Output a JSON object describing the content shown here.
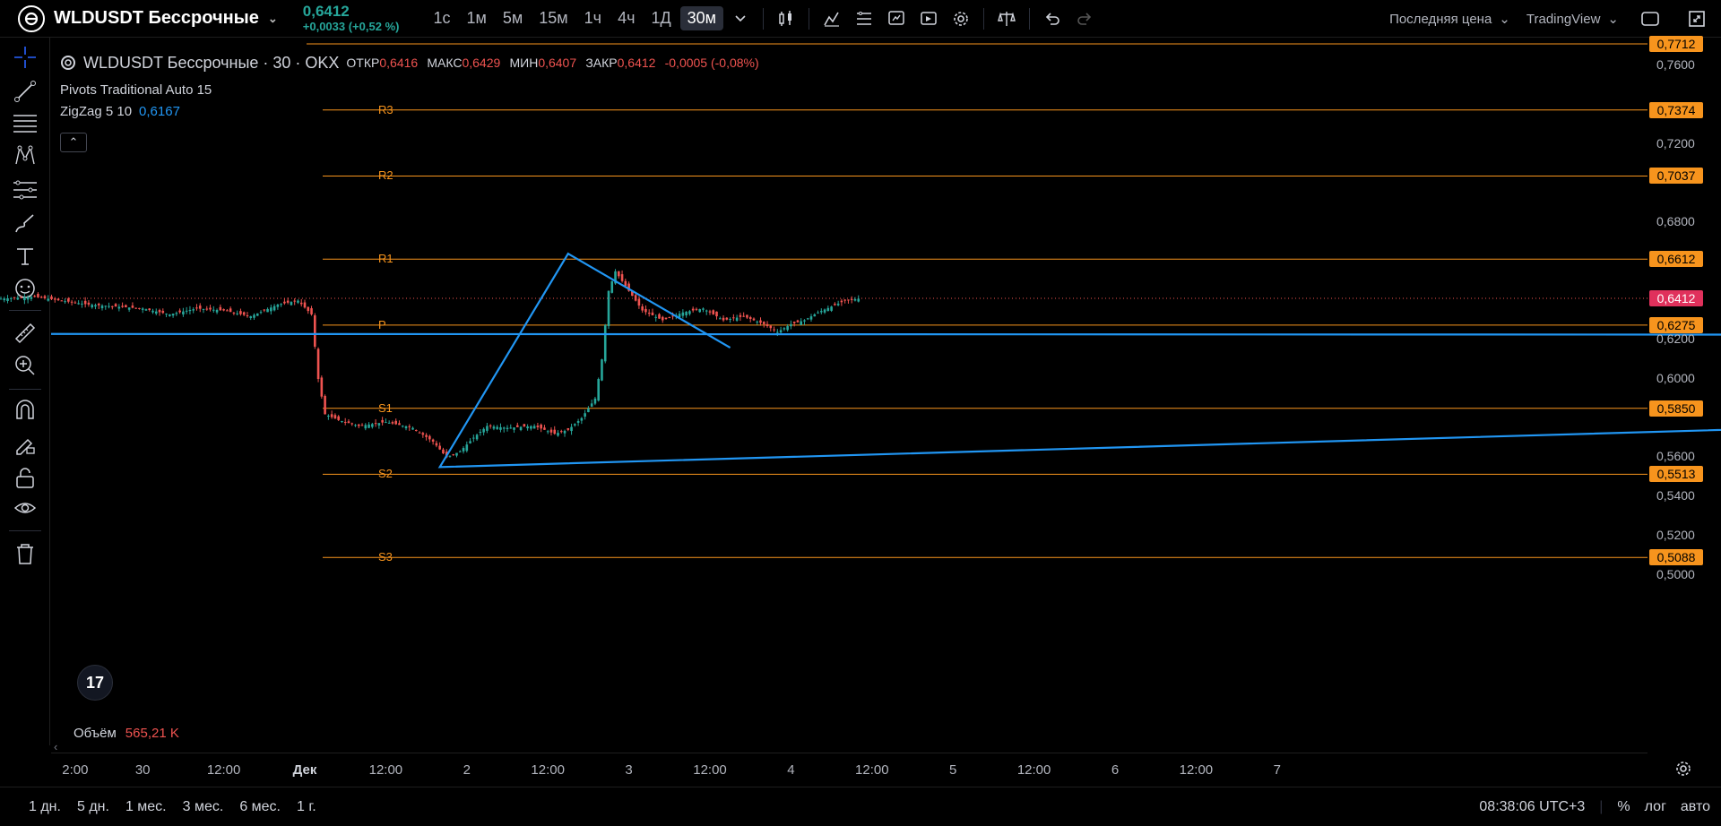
{
  "header": {
    "symbol": "WLDUSDT Бессрочные",
    "last_price": "0,6412",
    "change": "+0,0033 (+0,52 %)",
    "intervals": [
      "1с",
      "1м",
      "5м",
      "15м",
      "1ч",
      "4ч",
      "1Д",
      "30м"
    ],
    "active_interval": "30м",
    "price_type": "Последняя цена",
    "source": "TradingView"
  },
  "legend": {
    "title": "WLDUSDT Бессрочные · 30 · OKX",
    "open_label": "ОТКР",
    "open": "0,6416",
    "high_label": "МАКС",
    "high": "0,6429",
    "low_label": "МИН",
    "low": "0,6407",
    "close_label": "ЗАКР",
    "close": "0,6412",
    "change": "-0,0005 (-0,08%)",
    "indicator1": "Pivots Traditional Auto 15",
    "indicator2": "ZigZag 5 10",
    "indicator2_value": "0,6167"
  },
  "pivots": [
    {
      "label": "R3",
      "value": "0,7374"
    },
    {
      "label": "R2",
      "value": "0,7037"
    },
    {
      "label": "R1",
      "value": "0,6612"
    },
    {
      "label": "P",
      "value": "0,6275"
    },
    {
      "label": "S1",
      "value": "0,5850"
    },
    {
      "label": "S2",
      "value": "0,5513"
    },
    {
      "label": "S3",
      "value": "0,5088"
    }
  ],
  "top_level": "0,7712",
  "current_price_label": "0,6412",
  "price_ticks": [
    "0,7600",
    "0,7200",
    "0,6800",
    "0,6200",
    "0,6000",
    "0,5600",
    "0,5400",
    "0,5200",
    "0,5000"
  ],
  "time_ticks": [
    {
      "label": "2:00",
      "bold": false
    },
    {
      "label": "30",
      "bold": false
    },
    {
      "label": "12:00",
      "bold": false
    },
    {
      "label": "Дек",
      "bold": true
    },
    {
      "label": "12:00",
      "bold": false
    },
    {
      "label": "2",
      "bold": false
    },
    {
      "label": "12:00",
      "bold": false
    },
    {
      "label": "3",
      "bold": false
    },
    {
      "label": "12:00",
      "bold": false
    },
    {
      "label": "4",
      "bold": false
    },
    {
      "label": "12:00",
      "bold": false
    },
    {
      "label": "5",
      "bold": false
    },
    {
      "label": "12:00",
      "bold": false
    },
    {
      "label": "6",
      "bold": false
    },
    {
      "label": "12:00",
      "bold": false
    },
    {
      "label": "7",
      "bold": false
    }
  ],
  "volume": {
    "label": "Объём",
    "value": "565,21 K"
  },
  "ranges": [
    "1 дн.",
    "5 дн.",
    "1 мес.",
    "3 мес.",
    "6 мес.",
    "1 г."
  ],
  "clock": "08:38:06 UTC+3",
  "scale_percent": "%",
  "scale_log": "лог",
  "scale_auto": "авто",
  "colors": {
    "up": "#26a69a",
    "down": "#ef5350",
    "pivot": "#f7941d",
    "zigzag": "#2196f3"
  },
  "zigzag": [
    {
      "t": "29 Nov 18:00",
      "price": 0.622
    },
    {
      "t": "1 Dec 20:00",
      "price": 0.555
    },
    {
      "t": "2 Dec 15:00",
      "price": 0.664
    },
    {
      "t": "3 Dec 15:00",
      "price": 0.616
    }
  ]
}
